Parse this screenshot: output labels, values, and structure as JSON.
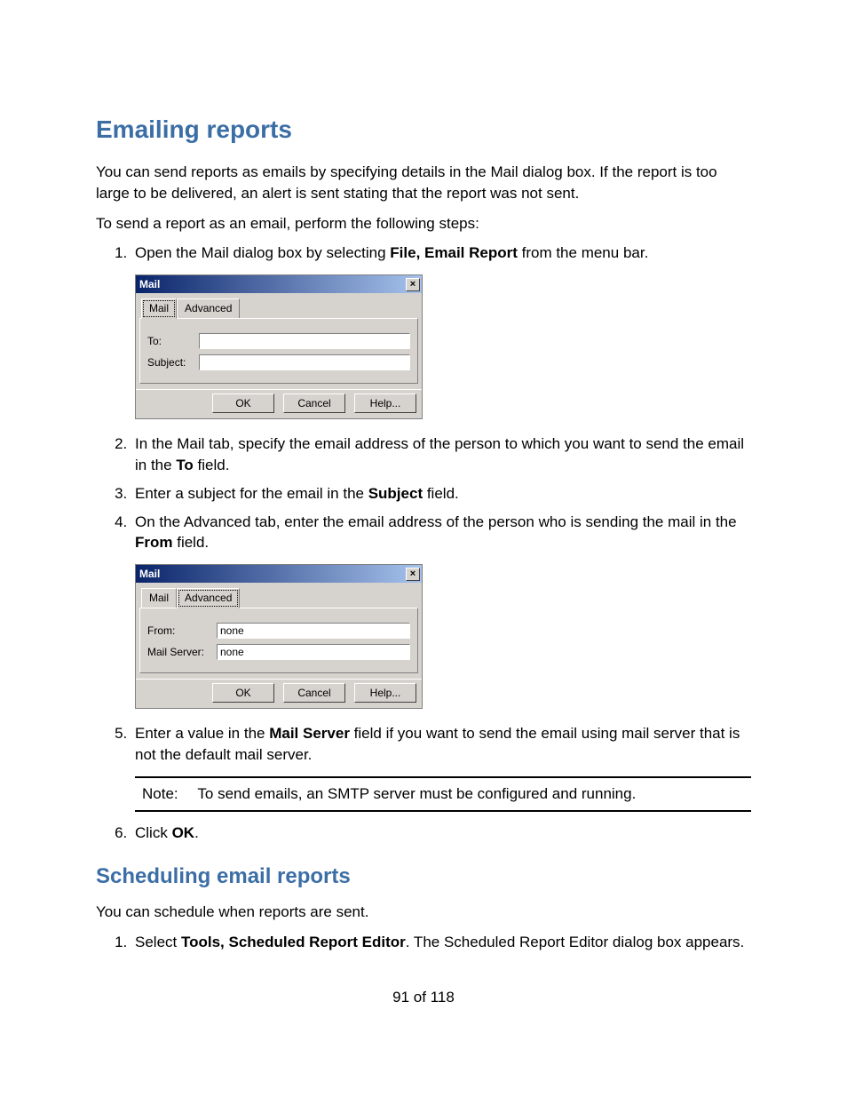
{
  "page_number": "91 of 118",
  "h1": "Emailing reports",
  "intro_p1": "You can send reports as emails by specifying details in the Mail dialog box. If the report is too large to be delivered, an alert is sent stating that the report was not sent.",
  "intro_p2": "To send a report as an email, perform the following steps:",
  "step1_pre": "Open the Mail dialog box by selecting ",
  "step1_bold": "File, Email Report",
  "step1_post": " from the menu bar.",
  "step2_pre": "In the Mail tab, specify the email address of the person to which you want to send the email in the ",
  "step2_bold": "To",
  "step2_post": " field.",
  "step3_pre": "Enter a subject for the email in the ",
  "step3_bold": "Subject",
  "step3_post": " field.",
  "step4_pre": "On the Advanced tab, enter the email address of the person who is sending the mail in the ",
  "step4_bold": "From",
  "step4_post": " field.",
  "step5_pre": "Enter a value in the ",
  "step5_bold": "Mail Server",
  "step5_post": " field if you want to send the email using mail server that is not the default mail server.",
  "note_label": "Note:",
  "note_text": "To send emails, an SMTP server must be configured and running.",
  "step6_pre": "Click ",
  "step6_bold": "OK",
  "step6_post": ".",
  "h2": "Scheduling email reports",
  "sched_p": "You can schedule when reports are sent.",
  "sched_step1_pre": "Select ",
  "sched_step1_bold": "Tools, Scheduled Report Editor",
  "sched_step1_post": ". The Scheduled Report Editor dialog box appears.",
  "dialog1": {
    "title": "Mail",
    "close": "×",
    "tabs": {
      "mail": "Mail",
      "advanced": "Advanced"
    },
    "labels": {
      "to": "To:",
      "subject": "Subject:"
    },
    "values": {
      "to": "",
      "subject": ""
    },
    "buttons": {
      "ok": "OK",
      "cancel": "Cancel",
      "help": "Help..."
    }
  },
  "dialog2": {
    "title": "Mail",
    "close": "×",
    "tabs": {
      "mail": "Mail",
      "advanced": "Advanced"
    },
    "labels": {
      "from": "From:",
      "server": "Mail Server:"
    },
    "values": {
      "from": "none",
      "server": "none"
    },
    "buttons": {
      "ok": "OK",
      "cancel": "Cancel",
      "help": "Help..."
    }
  }
}
